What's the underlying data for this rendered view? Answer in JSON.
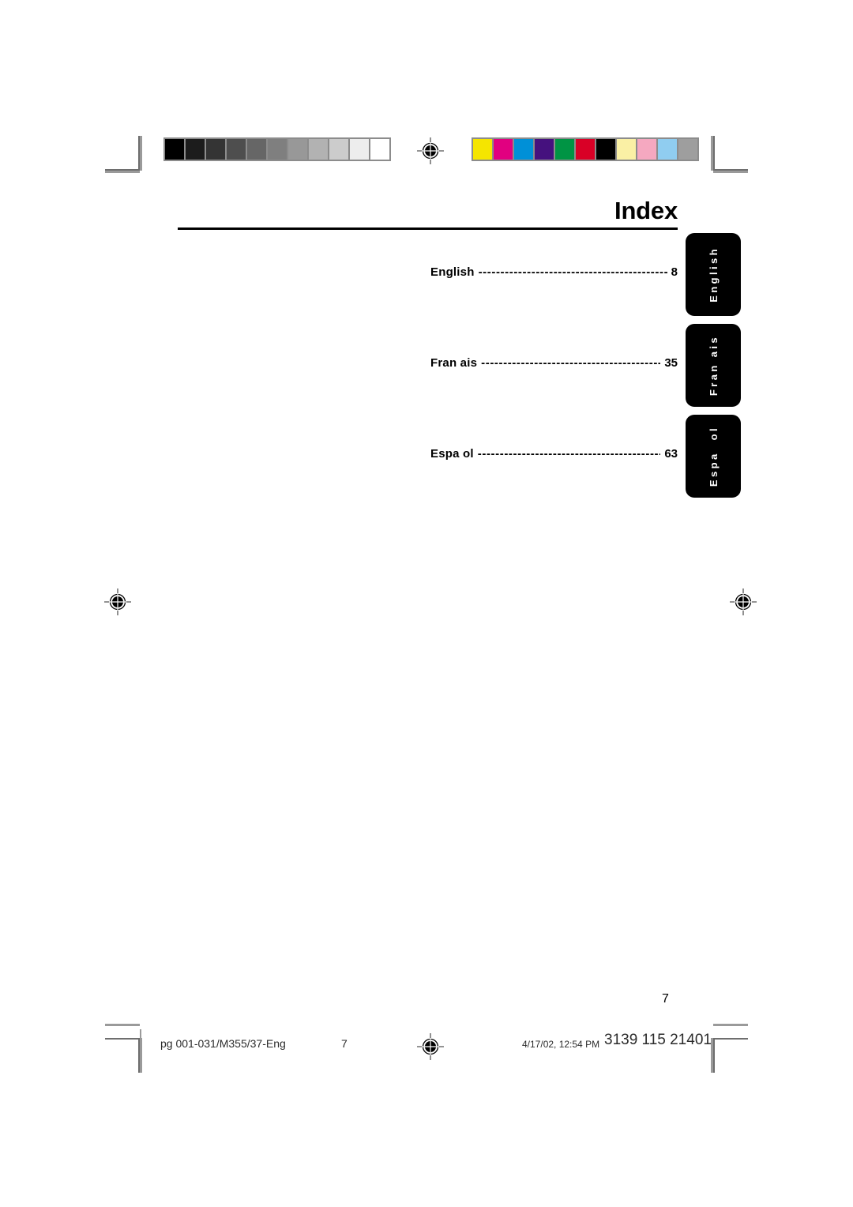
{
  "document": {
    "title": "Index",
    "folio": "7"
  },
  "toc": {
    "entries": [
      {
        "label": "English",
        "leader": "-------------------------------------------",
        "page": "8"
      },
      {
        "label": "Fran ais",
        "leader": "-------------------------------------------",
        "page": "35"
      },
      {
        "label": "Espa ol",
        "leader": "-------------------------------------------",
        "page": "63"
      }
    ]
  },
  "tabs": [
    {
      "name": "english",
      "label": "English"
    },
    {
      "name": "francais",
      "label": "Fran ais"
    },
    {
      "name": "espanol",
      "label": "Espa  ol"
    }
  ],
  "print_slug": {
    "filename": "pg 001-031/M355/37-Eng",
    "page_number": "7",
    "timestamp": "4/17/02, 12:54 PM",
    "code": "3139 115 21401"
  },
  "calibration": {
    "greyscale_label": "greyscale-calibration-strip",
    "greyscale_swatches": [
      "#000000",
      "#1c1c1c",
      "#343434",
      "#4e4e4e",
      "#666666",
      "#7f7f7f",
      "#989898",
      "#b2b2b2",
      "#cccccc",
      "#ededed",
      "#ffffff"
    ],
    "color_label": "color-calibration-strip",
    "color_swatches": [
      "#f5e500",
      "#e10080",
      "#0090d7",
      "#45117e",
      "#009444",
      "#d90026",
      "#000000",
      "#faf0a5",
      "#f5a8c0",
      "#90cdf0",
      "#9e9e9e"
    ]
  },
  "marks": {
    "registration_label": "registration-target",
    "crop_label": "crop-mark"
  }
}
